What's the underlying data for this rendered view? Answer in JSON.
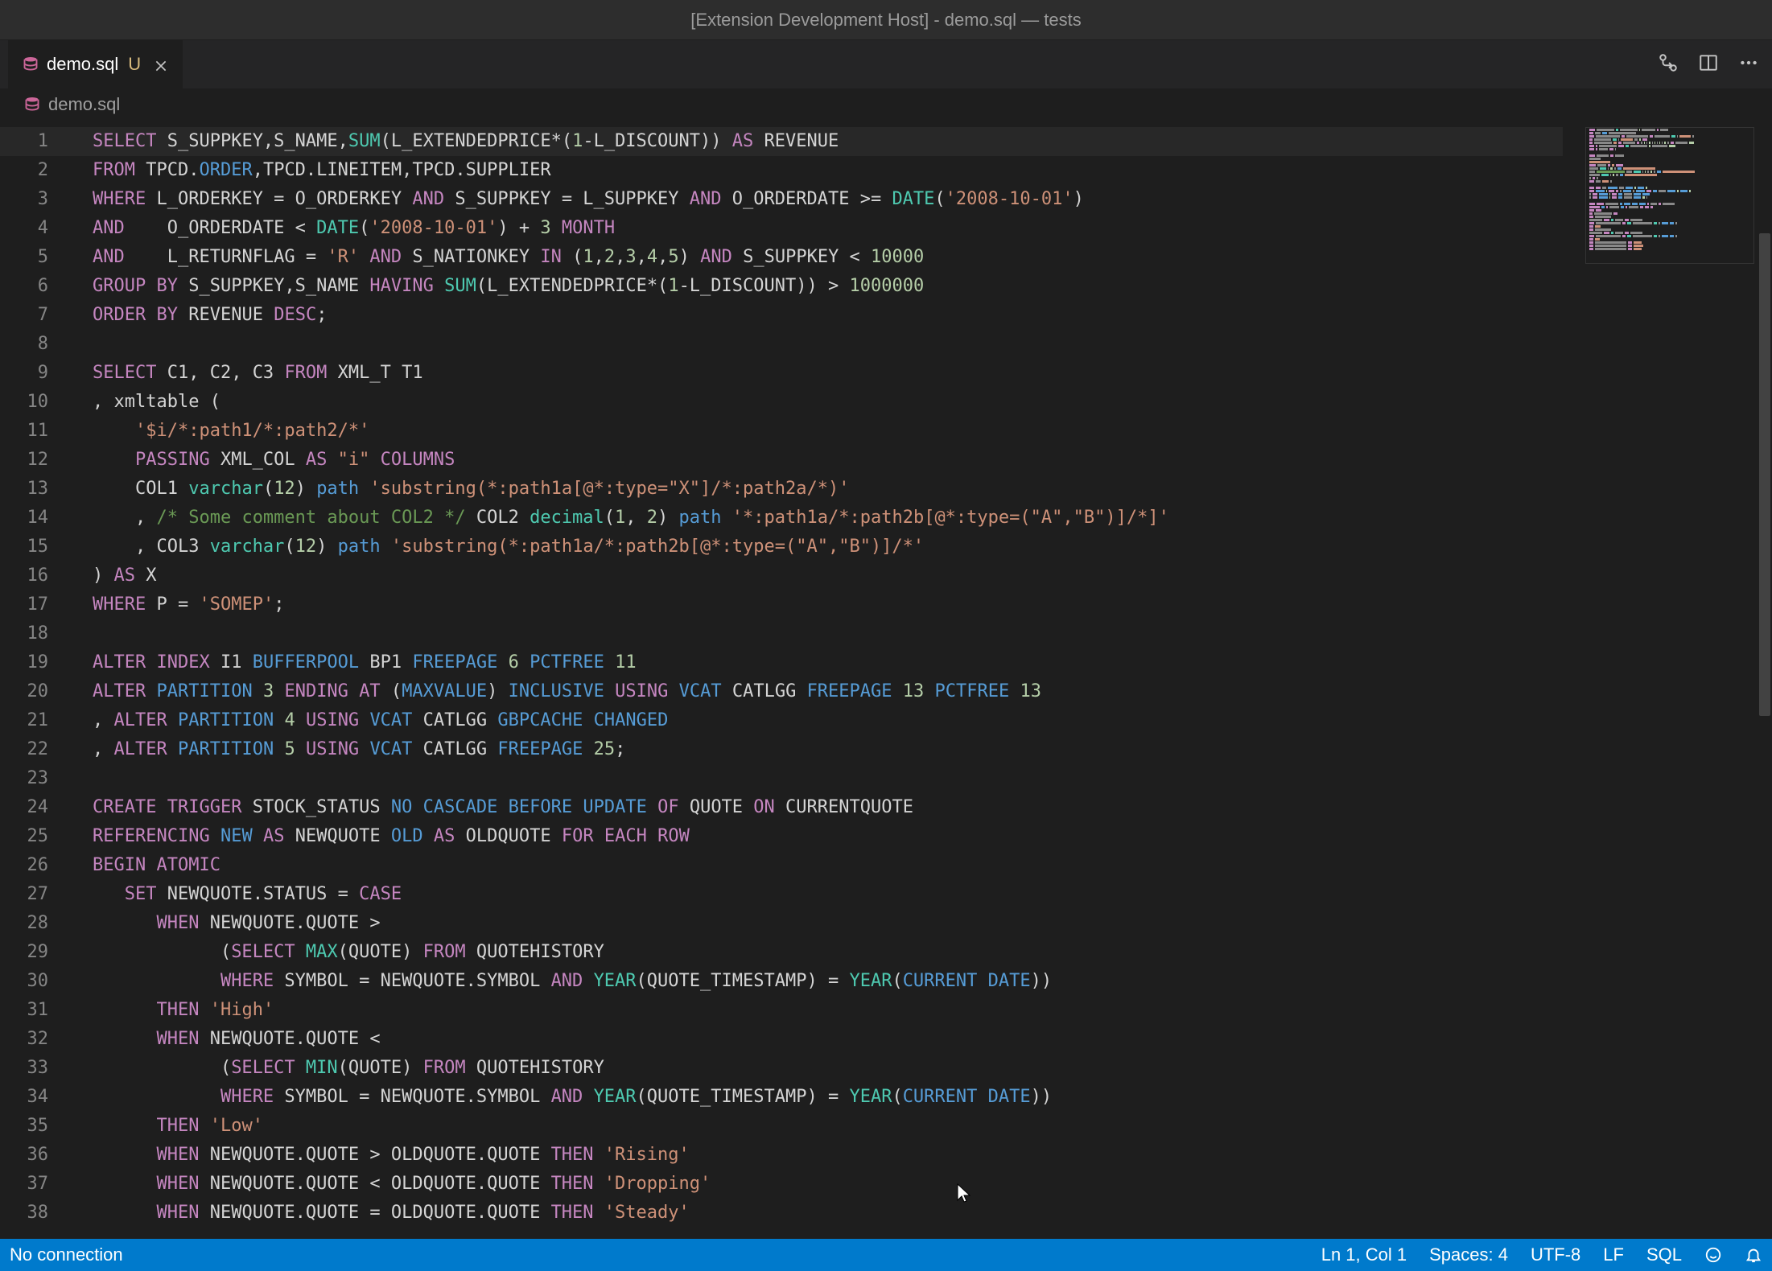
{
  "title": "[Extension Development Host] - demo.sql — tests",
  "tab": {
    "name": "demo.sql",
    "modified": "U"
  },
  "breadcrumb": {
    "name": "demo.sql"
  },
  "status": {
    "left": "No connection",
    "lncol": "Ln 1, Col 1",
    "spaces": "Spaces: 4",
    "encoding": "UTF-8",
    "eol": "LF",
    "lang": "SQL"
  },
  "code": [
    [
      [
        "kw",
        "SELECT"
      ],
      [
        "id",
        " S_SUPPKEY,S_NAME,"
      ],
      [
        "fn",
        "SUM"
      ],
      [
        "id",
        "(L_EXTENDEDPRICE*("
      ],
      [
        "num",
        "1"
      ],
      [
        "id",
        "-L_DISCOUNT)) "
      ],
      [
        "kw",
        "AS"
      ],
      [
        "id",
        " REVENUE"
      ]
    ],
    [
      [
        "kw",
        "FROM"
      ],
      [
        "id",
        " TPCD."
      ],
      [
        "blue",
        "ORDER"
      ],
      [
        "id",
        ",TPCD.LINEITEM,TPCD.SUPPLIER"
      ]
    ],
    [
      [
        "kw",
        "WHERE"
      ],
      [
        "id",
        " L_ORDERKEY = O_ORDERKEY "
      ],
      [
        "kw",
        "AND"
      ],
      [
        "id",
        " S_SUPPKEY = L_SUPPKEY "
      ],
      [
        "kw",
        "AND"
      ],
      [
        "id",
        " O_ORDERDATE >= "
      ],
      [
        "fn",
        "DATE"
      ],
      [
        "id",
        "("
      ],
      [
        "str",
        "'2008-10-01'"
      ],
      [
        "id",
        ")"
      ]
    ],
    [
      [
        "kw",
        "AND"
      ],
      [
        "id",
        "    O_ORDERDATE < "
      ],
      [
        "fn",
        "DATE"
      ],
      [
        "id",
        "("
      ],
      [
        "str",
        "'2008-10-01'"
      ],
      [
        "id",
        ") + "
      ],
      [
        "num",
        "3"
      ],
      [
        "id",
        " "
      ],
      [
        "kw",
        "MONTH"
      ]
    ],
    [
      [
        "kw",
        "AND"
      ],
      [
        "id",
        "    L_RETURNFLAG = "
      ],
      [
        "str",
        "'R'"
      ],
      [
        "id",
        " "
      ],
      [
        "kw",
        "AND"
      ],
      [
        "id",
        " S_NATIONKEY "
      ],
      [
        "kw",
        "IN"
      ],
      [
        "id",
        " ("
      ],
      [
        "num",
        "1"
      ],
      [
        "id",
        ","
      ],
      [
        "num",
        "2"
      ],
      [
        "id",
        ","
      ],
      [
        "num",
        "3"
      ],
      [
        "id",
        ","
      ],
      [
        "num",
        "4"
      ],
      [
        "id",
        ","
      ],
      [
        "num",
        "5"
      ],
      [
        "id",
        ") "
      ],
      [
        "kw",
        "AND"
      ],
      [
        "id",
        " S_SUPPKEY < "
      ],
      [
        "num",
        "10000"
      ]
    ],
    [
      [
        "kw",
        "GROUP"
      ],
      [
        "id",
        " "
      ],
      [
        "kw",
        "BY"
      ],
      [
        "id",
        " S_SUPPKEY,S_NAME "
      ],
      [
        "kw",
        "HAVING"
      ],
      [
        "id",
        " "
      ],
      [
        "fn",
        "SUM"
      ],
      [
        "id",
        "(L_EXTENDEDPRICE*("
      ],
      [
        "num",
        "1"
      ],
      [
        "id",
        "-L_DISCOUNT)) > "
      ],
      [
        "num",
        "1000000"
      ]
    ],
    [
      [
        "kw",
        "ORDER"
      ],
      [
        "id",
        " "
      ],
      [
        "kw",
        "BY"
      ],
      [
        "id",
        " REVENUE "
      ],
      [
        "kw",
        "DESC"
      ],
      [
        "id",
        ";"
      ]
    ],
    [
      [
        "id",
        ""
      ]
    ],
    [
      [
        "kw",
        "SELECT"
      ],
      [
        "id",
        " C1, C2, C3 "
      ],
      [
        "kw",
        "FROM"
      ],
      [
        "id",
        " XML_T T1"
      ]
    ],
    [
      [
        "id",
        ", xmltable ("
      ]
    ],
    [
      [
        "id",
        "    "
      ],
      [
        "str",
        "'$i/*:path1/*:path2/*'"
      ]
    ],
    [
      [
        "id",
        "    "
      ],
      [
        "kw",
        "PASSING"
      ],
      [
        "id",
        " XML_COL "
      ],
      [
        "kw",
        "AS"
      ],
      [
        "id",
        " "
      ],
      [
        "str",
        "\"i\""
      ],
      [
        "id",
        " "
      ],
      [
        "kw",
        "COLUMNS"
      ]
    ],
    [
      [
        "id",
        "    COL1 "
      ],
      [
        "type",
        "varchar"
      ],
      [
        "id",
        "("
      ],
      [
        "num",
        "12"
      ],
      [
        "id",
        ") "
      ],
      [
        "blue",
        "path"
      ],
      [
        "id",
        " "
      ],
      [
        "str",
        "'substring(*:path1a[@*:type=\"X\"]/*:path2a/*)'"
      ]
    ],
    [
      [
        "id",
        "    , "
      ],
      [
        "cmt",
        "/* Some comment about COL2 */"
      ],
      [
        "id",
        " COL2 "
      ],
      [
        "type",
        "decimal"
      ],
      [
        "id",
        "("
      ],
      [
        "num",
        "1"
      ],
      [
        "id",
        ", "
      ],
      [
        "num",
        "2"
      ],
      [
        "id",
        ") "
      ],
      [
        "blue",
        "path"
      ],
      [
        "id",
        " "
      ],
      [
        "str",
        "'*:path1a/*:path2b[@*:type=(\"A\",\"B\")]/*]'"
      ]
    ],
    [
      [
        "id",
        "    , COL3 "
      ],
      [
        "type",
        "varchar"
      ],
      [
        "id",
        "("
      ],
      [
        "num",
        "12"
      ],
      [
        "id",
        ") "
      ],
      [
        "blue",
        "path"
      ],
      [
        "id",
        " "
      ],
      [
        "str",
        "'substring(*:path1a/*:path2b[@*:type=(\"A\",\"B\")]/*'"
      ]
    ],
    [
      [
        "id",
        ") "
      ],
      [
        "kw",
        "AS"
      ],
      [
        "id",
        " X"
      ]
    ],
    [
      [
        "kw",
        "WHERE"
      ],
      [
        "id",
        " P = "
      ],
      [
        "str",
        "'SOMEP'"
      ],
      [
        "id",
        ";"
      ]
    ],
    [
      [
        "id",
        ""
      ]
    ],
    [
      [
        "kw",
        "ALTER"
      ],
      [
        "id",
        " "
      ],
      [
        "kw",
        "INDEX"
      ],
      [
        "id",
        " I1 "
      ],
      [
        "blue",
        "BUFFERPOOL"
      ],
      [
        "id",
        " BP1 "
      ],
      [
        "blue",
        "FREEPAGE"
      ],
      [
        "id",
        " "
      ],
      [
        "num",
        "6"
      ],
      [
        "id",
        " "
      ],
      [
        "blue",
        "PCTFREE"
      ],
      [
        "id",
        " "
      ],
      [
        "num",
        "11"
      ]
    ],
    [
      [
        "kw",
        "ALTER"
      ],
      [
        "id",
        " "
      ],
      [
        "blue",
        "PARTITION"
      ],
      [
        "id",
        " "
      ],
      [
        "num",
        "3"
      ],
      [
        "id",
        " "
      ],
      [
        "kw",
        "ENDING"
      ],
      [
        "id",
        " "
      ],
      [
        "kw",
        "AT"
      ],
      [
        "id",
        " ("
      ],
      [
        "blue",
        "MAXVALUE"
      ],
      [
        "id",
        ") "
      ],
      [
        "blue",
        "INCLUSIVE"
      ],
      [
        "id",
        " "
      ],
      [
        "kw",
        "USING"
      ],
      [
        "id",
        " "
      ],
      [
        "blue",
        "VCAT"
      ],
      [
        "id",
        " CATLGG "
      ],
      [
        "blue",
        "FREEPAGE"
      ],
      [
        "id",
        " "
      ],
      [
        "num",
        "13"
      ],
      [
        "id",
        " "
      ],
      [
        "blue",
        "PCTFREE"
      ],
      [
        "id",
        " "
      ],
      [
        "num",
        "13"
      ]
    ],
    [
      [
        "id",
        ", "
      ],
      [
        "kw",
        "ALTER"
      ],
      [
        "id",
        " "
      ],
      [
        "blue",
        "PARTITION"
      ],
      [
        "id",
        " "
      ],
      [
        "num",
        "4"
      ],
      [
        "id",
        " "
      ],
      [
        "kw",
        "USING"
      ],
      [
        "id",
        " "
      ],
      [
        "blue",
        "VCAT"
      ],
      [
        "id",
        " CATLGG "
      ],
      [
        "blue",
        "GBPCACHE"
      ],
      [
        "id",
        " "
      ],
      [
        "blue",
        "CHANGED"
      ]
    ],
    [
      [
        "id",
        ", "
      ],
      [
        "kw",
        "ALTER"
      ],
      [
        "id",
        " "
      ],
      [
        "blue",
        "PARTITION"
      ],
      [
        "id",
        " "
      ],
      [
        "num",
        "5"
      ],
      [
        "id",
        " "
      ],
      [
        "kw",
        "USING"
      ],
      [
        "id",
        " "
      ],
      [
        "blue",
        "VCAT"
      ],
      [
        "id",
        " CATLGG "
      ],
      [
        "blue",
        "FREEPAGE"
      ],
      [
        "id",
        " "
      ],
      [
        "num",
        "25"
      ],
      [
        "id",
        ";"
      ]
    ],
    [
      [
        "id",
        ""
      ]
    ],
    [
      [
        "kw",
        "CREATE"
      ],
      [
        "id",
        " "
      ],
      [
        "kw",
        "TRIGGER"
      ],
      [
        "id",
        " STOCK_STATUS "
      ],
      [
        "blue",
        "NO"
      ],
      [
        "id",
        " "
      ],
      [
        "blue",
        "CASCADE"
      ],
      [
        "id",
        " "
      ],
      [
        "blue",
        "BEFORE"
      ],
      [
        "id",
        " "
      ],
      [
        "blue",
        "UPDATE"
      ],
      [
        "id",
        " "
      ],
      [
        "kw",
        "OF"
      ],
      [
        "id",
        " QUOTE "
      ],
      [
        "kw",
        "ON"
      ],
      [
        "id",
        " CURRENTQUOTE"
      ]
    ],
    [
      [
        "kw",
        "REFERENCING"
      ],
      [
        "id",
        " "
      ],
      [
        "blue",
        "NEW"
      ],
      [
        "id",
        " "
      ],
      [
        "kw",
        "AS"
      ],
      [
        "id",
        " NEWQUOTE "
      ],
      [
        "blue",
        "OLD"
      ],
      [
        "id",
        " "
      ],
      [
        "kw",
        "AS"
      ],
      [
        "id",
        " OLDQUOTE "
      ],
      [
        "kw",
        "FOR"
      ],
      [
        "id",
        " "
      ],
      [
        "kw",
        "EACH"
      ],
      [
        "id",
        " "
      ],
      [
        "kw",
        "ROW"
      ]
    ],
    [
      [
        "kw",
        "BEGIN"
      ],
      [
        "id",
        " "
      ],
      [
        "kw",
        "ATOMIC"
      ]
    ],
    [
      [
        "id",
        "   "
      ],
      [
        "kw",
        "SET"
      ],
      [
        "id",
        " NEWQUOTE.STATUS = "
      ],
      [
        "kw",
        "CASE"
      ]
    ],
    [
      [
        "id",
        "      "
      ],
      [
        "kw",
        "WHEN"
      ],
      [
        "id",
        " NEWQUOTE.QUOTE >"
      ]
    ],
    [
      [
        "id",
        "            ("
      ],
      [
        "kw",
        "SELECT"
      ],
      [
        "id",
        " "
      ],
      [
        "fn",
        "MAX"
      ],
      [
        "id",
        "(QUOTE) "
      ],
      [
        "kw",
        "FROM"
      ],
      [
        "id",
        " QUOTEHISTORY"
      ]
    ],
    [
      [
        "id",
        "            "
      ],
      [
        "kw",
        "WHERE"
      ],
      [
        "id",
        " SYMBOL = NEWQUOTE.SYMBOL "
      ],
      [
        "kw",
        "AND"
      ],
      [
        "id",
        " "
      ],
      [
        "fn",
        "YEAR"
      ],
      [
        "id",
        "(QUOTE_TIMESTAMP) = "
      ],
      [
        "fn",
        "YEAR"
      ],
      [
        "id",
        "("
      ],
      [
        "blue",
        "CURRENT"
      ],
      [
        "id",
        " "
      ],
      [
        "blue",
        "DATE"
      ],
      [
        "id",
        "))"
      ]
    ],
    [
      [
        "id",
        "      "
      ],
      [
        "kw",
        "THEN"
      ],
      [
        "id",
        " "
      ],
      [
        "str",
        "'High'"
      ]
    ],
    [
      [
        "id",
        "      "
      ],
      [
        "kw",
        "WHEN"
      ],
      [
        "id",
        " NEWQUOTE.QUOTE <"
      ]
    ],
    [
      [
        "id",
        "            ("
      ],
      [
        "kw",
        "SELECT"
      ],
      [
        "id",
        " "
      ],
      [
        "fn",
        "MIN"
      ],
      [
        "id",
        "(QUOTE) "
      ],
      [
        "kw",
        "FROM"
      ],
      [
        "id",
        " QUOTEHISTORY"
      ]
    ],
    [
      [
        "id",
        "            "
      ],
      [
        "kw",
        "WHERE"
      ],
      [
        "id",
        " SYMBOL = NEWQUOTE.SYMBOL "
      ],
      [
        "kw",
        "AND"
      ],
      [
        "id",
        " "
      ],
      [
        "fn",
        "YEAR"
      ],
      [
        "id",
        "(QUOTE_TIMESTAMP) = "
      ],
      [
        "fn",
        "YEAR"
      ],
      [
        "id",
        "("
      ],
      [
        "blue",
        "CURRENT"
      ],
      [
        "id",
        " "
      ],
      [
        "blue",
        "DATE"
      ],
      [
        "id",
        "))"
      ]
    ],
    [
      [
        "id",
        "      "
      ],
      [
        "kw",
        "THEN"
      ],
      [
        "id",
        " "
      ],
      [
        "str",
        "'Low'"
      ]
    ],
    [
      [
        "id",
        "      "
      ],
      [
        "kw",
        "WHEN"
      ],
      [
        "id",
        " NEWQUOTE.QUOTE > OLDQUOTE.QUOTE "
      ],
      [
        "kw",
        "THEN"
      ],
      [
        "id",
        " "
      ],
      [
        "str",
        "'Rising'"
      ]
    ],
    [
      [
        "id",
        "      "
      ],
      [
        "kw",
        "WHEN"
      ],
      [
        "id",
        " NEWQUOTE.QUOTE < OLDQUOTE.QUOTE "
      ],
      [
        "kw",
        "THEN"
      ],
      [
        "id",
        " "
      ],
      [
        "str",
        "'Dropping'"
      ]
    ],
    [
      [
        "id",
        "      "
      ],
      [
        "kw",
        "WHEN"
      ],
      [
        "id",
        " NEWQUOTE.QUOTE = OLDQUOTE.QUOTE "
      ],
      [
        "kw",
        "THEN"
      ],
      [
        "id",
        " "
      ],
      [
        "str",
        "'Steady'"
      ]
    ]
  ]
}
